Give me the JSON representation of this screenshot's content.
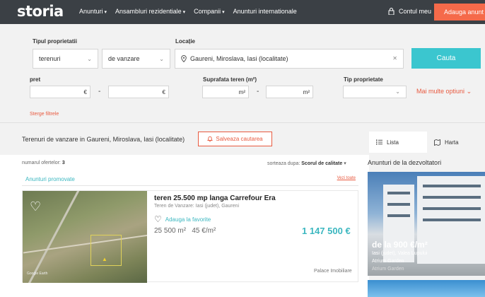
{
  "header": {
    "logo": "storia",
    "nav": [
      "Anunturi",
      "Ansambluri rezidentiale",
      "Companii",
      "Anunturi internationale"
    ],
    "account": "Contul meu",
    "add_listing": "Adauga anunt"
  },
  "search": {
    "property_type_label": "Tipul proprietatii",
    "property_type": "terenuri",
    "transaction_type": "de vanzare",
    "location_label": "Locație",
    "location": "Gaureni, Miroslava, Iasi (localitate)",
    "search_button": "Cauta",
    "price_label": "pret",
    "price_currency": "€",
    "area_label": "Suprafata teren (m²)",
    "area_unit": "m²",
    "type_label": "Tip proprietate",
    "more_options": "Mai multe optiuni",
    "clear_filters": "Sterge filtrele"
  },
  "results": {
    "title": "Terenuri de vanzare in Gaureni, Miroslava, Iasi (localitate)",
    "save_search": "Salveaza cautarea",
    "tab_list": "Lista",
    "tab_map": "Harta",
    "count_label": "numarul ofertelor:",
    "count": "3",
    "sort_label": "sorteaza dupa:",
    "sort_value": "Scorul de calitate",
    "promoted_label": "Anunturi promovate",
    "see_all": "Vezi toate"
  },
  "listing": {
    "title": "teren 25.500 mp langa Carrefour Era",
    "subtitle": "Teren de Vanzare: Iasi (judet), Gaureni",
    "favorite": "Adauga la favorite",
    "area": "25 500 m²",
    "price_per_m2": "45 €/m²",
    "price": "1 147 500 €",
    "agency": "Palace Imobiliare",
    "image_caption": "Google Earth"
  },
  "developers": {
    "title": "Anunturi de la dezvoltatori",
    "price": "de la 900 €/m²",
    "location": "Iasi (judet), Valea Lupului",
    "name": "Atrium Garden",
    "name_sub": "Atrium Garden"
  },
  "colors": {
    "accent": "#3bc6cf",
    "orange": "#f56a4a",
    "nav_bg": "#3b4045"
  }
}
